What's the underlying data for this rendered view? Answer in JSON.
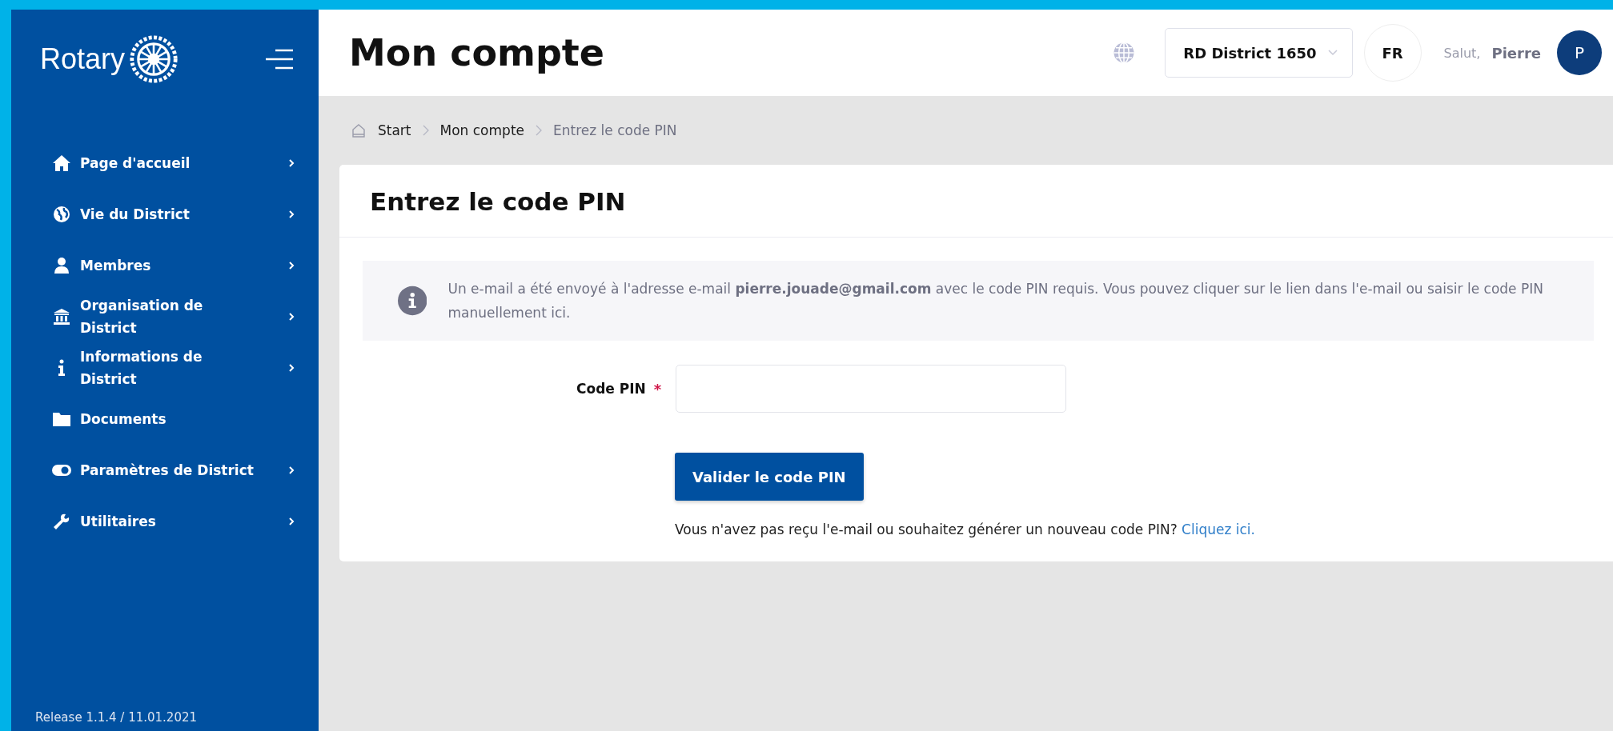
{
  "sidebar": {
    "logo_text": "Rotary",
    "items": [
      {
        "label": "Page d'accueil",
        "expandable": true
      },
      {
        "label": "Vie du District",
        "expandable": true
      },
      {
        "label": "Membres",
        "expandable": true
      },
      {
        "label": "Organisation de District",
        "expandable": true
      },
      {
        "label": "Informations de District",
        "expandable": true
      },
      {
        "label": "Documents",
        "expandable": false
      },
      {
        "label": "Paramètres de District",
        "expandable": true
      },
      {
        "label": "Utilitaires",
        "expandable": true
      }
    ],
    "release": "Release 1.1.4 / 11.01.2021"
  },
  "header": {
    "title": "Mon compte",
    "district_select": "RD District 1650",
    "language": "FR",
    "greeting": "Salut,",
    "user_name": "Pierre",
    "avatar_initial": "P"
  },
  "breadcrumb": [
    "Start",
    "Mon compte",
    "Entrez le code PIN"
  ],
  "card": {
    "title": "Entrez le code PIN",
    "info": "Un e-mail a été envoyé à l'adresse e-mail **pierre.jouade@gmail.com** avec le code PIN requis. Vous pouvez cliquer sur le lien dans l'e-mail ou saisir le code PIN manuellement ici.",
    "field_label": "Code PIN",
    "required_mark": "*",
    "submit": "Valider le code PIN",
    "resend_text": "Vous n'avez pas reçu l'e-mail ou souhaitez générer un nouveau code PIN?",
    "resend_link": "Cliquez ici."
  }
}
